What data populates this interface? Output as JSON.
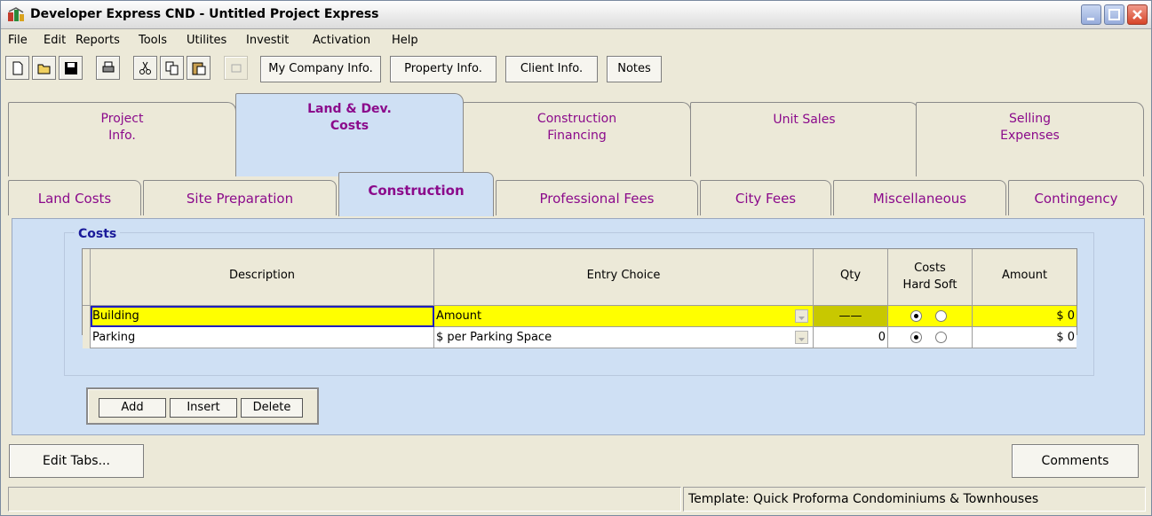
{
  "window": {
    "title": "Developer Express  CND - Untitled Project Express",
    "controls": [
      "minimize-icon",
      "maximize-icon",
      "close-icon"
    ]
  },
  "menu": [
    "File",
    "Edit",
    "Reports",
    "Tools",
    "Utilites",
    "Investit",
    "Activation",
    "Help"
  ],
  "toolbar": {
    "icons": [
      "new-document-icon",
      "open-folder-icon",
      "save-disk-icon",
      "print-icon",
      "cut-icon",
      "copy-icon",
      "paste-icon",
      "disabled-icon"
    ],
    "buttons": [
      "My Company Info.",
      "Property Info.",
      "Client Info.",
      "Notes"
    ]
  },
  "main_tabs": [
    {
      "label": "Project\nInfo.",
      "active": false
    },
    {
      "label": "Land & Dev.\nCosts",
      "active": true
    },
    {
      "label": "Construction\nFinancing",
      "active": false
    },
    {
      "label": "Unit Sales",
      "active": false
    },
    {
      "label": "Selling\nExpenses",
      "active": false
    }
  ],
  "sub_tabs": [
    {
      "label": "Land Costs",
      "active": false
    },
    {
      "label": "Site Preparation",
      "active": false
    },
    {
      "label": "Construction",
      "active": true
    },
    {
      "label": "Professional Fees",
      "active": false
    },
    {
      "label": "City Fees",
      "active": false
    },
    {
      "label": "Miscellaneous",
      "active": false
    },
    {
      "label": "Contingency",
      "active": false
    }
  ],
  "costs": {
    "group_title": "Costs",
    "columns": {
      "description": "Description",
      "entry_choice": "Entry Choice",
      "qty": "Qty",
      "costs_top": "Costs",
      "costs_bottom": "Hard Soft",
      "amount": "Amount"
    },
    "rows": [
      {
        "description": "Building",
        "entry_choice": "Amount",
        "qty": "——",
        "cost_type": "Hard",
        "amount": "$ 0",
        "selected": true
      },
      {
        "description": "Parking",
        "entry_choice": "$ per Parking Space",
        "qty": "0",
        "cost_type": "Hard",
        "amount": "$ 0",
        "selected": false
      }
    ],
    "actions": [
      "Add",
      "Insert",
      "Delete"
    ]
  },
  "footer": {
    "edit_tabs": "Edit Tabs...",
    "comments": "Comments"
  },
  "status": {
    "left": "",
    "template": "Template: Quick Proforma Condominiums & Townhouses"
  }
}
